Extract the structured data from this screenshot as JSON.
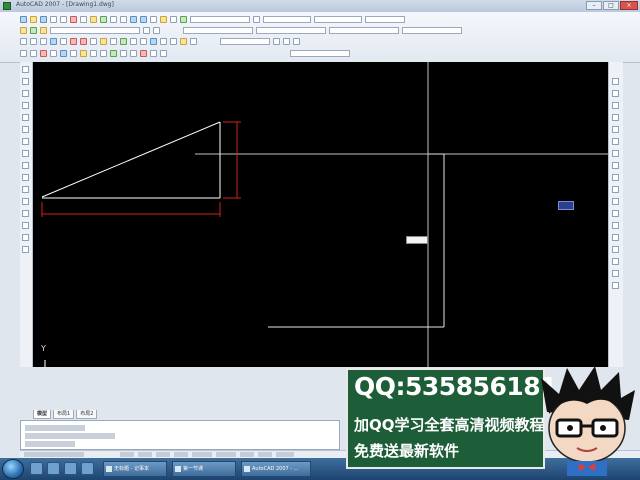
{
  "window": {
    "title": "AutoCAD 2007 - [Drawing1.dwg]"
  },
  "canvas": {
    "ucs_x_label": "X",
    "ucs_y_label": "Y"
  },
  "layout_tabs": [
    "模型",
    "布局1",
    "布局2"
  ],
  "taskbar": {
    "items": [
      "无标题 - 记事本",
      "第一节课",
      "AutoCAD 2007 - ..."
    ]
  },
  "promo": {
    "qq": "QQ:535856181",
    "line1": "加QQ学习全套高清视频教程",
    "line2": "免费送最新软件"
  },
  "colors": {
    "canvas_bg": "#000000",
    "geometry": "#ffffff",
    "dimension": "#d22222",
    "promo_bg": "#1d5d38",
    "taskbar": "#2d5a87"
  }
}
